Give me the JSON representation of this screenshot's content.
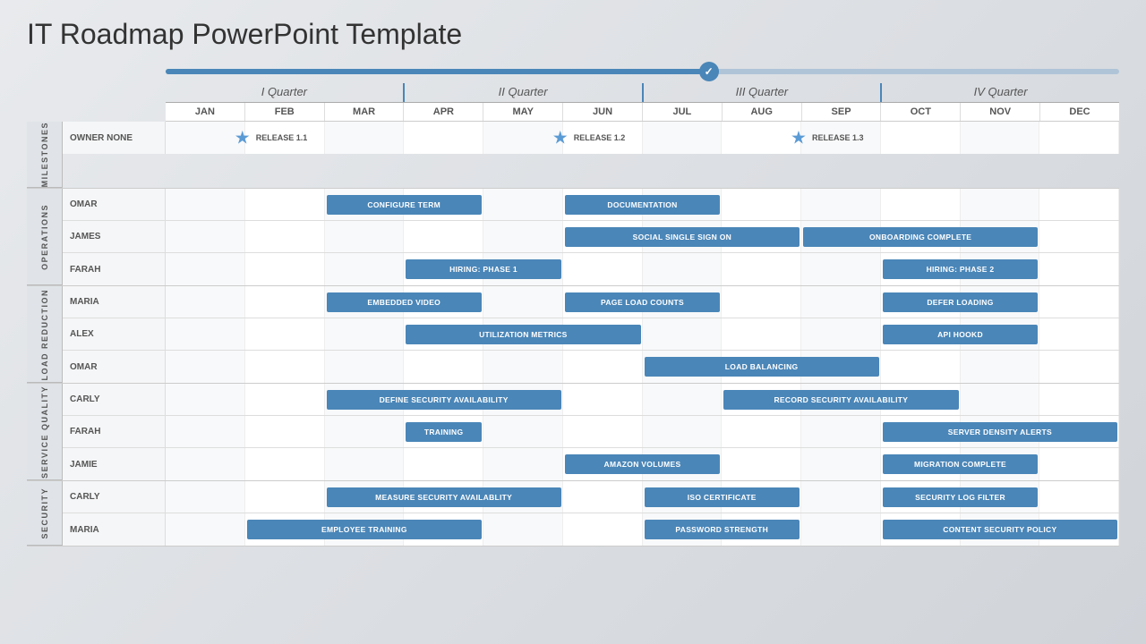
{
  "title": "IT Roadmap PowerPoint Template",
  "progress": {
    "fill_percent": 58
  },
  "quarters": [
    {
      "label": "I Quarter"
    },
    {
      "label": "II Quarter"
    },
    {
      "label": "III Quarter"
    },
    {
      "label": "IV Quarter"
    }
  ],
  "months": [
    "JAN",
    "FEB",
    "MAR",
    "APR",
    "MAY",
    "JUN",
    "JUL",
    "AUG",
    "SEP",
    "OCT",
    "NOV",
    "DEC"
  ],
  "sections": [
    {
      "label": "MILESTONES",
      "rows": [
        {
          "owner": "OWNER NONE",
          "tasks": [
            {
              "label": "RELEASE 1.1",
              "start": 2,
              "span": 2,
              "type": "milestone",
              "star": true
            },
            {
              "label": "RELEASE 1.2",
              "start": 6,
              "span": 2,
              "type": "milestone",
              "star": true
            },
            {
              "label": "RELEASE 1.3",
              "start": 9,
              "span": 2,
              "type": "milestone",
              "star": true
            }
          ]
        }
      ]
    },
    {
      "label": "OPERATIONS",
      "rows": [
        {
          "owner": "OMAR",
          "tasks": [
            {
              "label": "CONFIGURE TERM",
              "start": 3,
              "span": 2
            },
            {
              "label": "DOCUMENTATION",
              "start": 6,
              "span": 2
            }
          ]
        },
        {
          "owner": "JAMES",
          "tasks": [
            {
              "label": "SOCIAL SINGLE SIGN ON",
              "start": 6,
              "span": 3
            },
            {
              "label": "ONBOARDING COMPLETE",
              "start": 9,
              "span": 3
            }
          ]
        },
        {
          "owner": "FARAH",
          "tasks": [
            {
              "label": "HIRING: PHASE 1",
              "start": 4,
              "span": 2
            },
            {
              "label": "HIRING: PHASE 2",
              "start": 10,
              "span": 2
            }
          ]
        }
      ]
    },
    {
      "label": "LOAD REDUCTION",
      "rows": [
        {
          "owner": "MARIA",
          "tasks": [
            {
              "label": "EMBEDDED VIDEO",
              "start": 3,
              "span": 2
            },
            {
              "label": "PAGE LOAD COUNTS",
              "start": 6,
              "span": 2
            },
            {
              "label": "DEFER LOADING",
              "start": 10,
              "span": 2
            }
          ]
        },
        {
          "owner": "ALEX",
          "tasks": [
            {
              "label": "UTILIZATION METRICS",
              "start": 4,
              "span": 3
            },
            {
              "label": "API HOOKD",
              "start": 10,
              "span": 2
            }
          ]
        },
        {
          "owner": "OMAR",
          "tasks": [
            {
              "label": "LOAD BALANCING",
              "start": 7,
              "span": 3
            }
          ]
        }
      ]
    },
    {
      "label": "SERVICE QUALITY",
      "rows": [
        {
          "owner": "CARLY",
          "tasks": [
            {
              "label": "DEFINE SECURITY AVAILABILITY",
              "start": 3,
              "span": 3
            },
            {
              "label": "RECORD SECURITY AVAILABILITY",
              "start": 8,
              "span": 3
            }
          ]
        },
        {
          "owner": "FARAH",
          "tasks": [
            {
              "label": "TRAINING",
              "start": 4,
              "span": 1
            },
            {
              "label": "SERVER DENSITY ALERTS",
              "start": 10,
              "span": 3
            }
          ]
        },
        {
          "owner": "JAMIE",
          "tasks": [
            {
              "label": "AMAZON VOLUMES",
              "start": 6,
              "span": 2
            },
            {
              "label": "MIGRATION COMPLETE",
              "start": 10,
              "span": 2
            }
          ]
        }
      ]
    },
    {
      "label": "SECURITY",
      "rows": [
        {
          "owner": "CARLY",
          "tasks": [
            {
              "label": "MEASURE SECURITY AVAILABLITY",
              "start": 3,
              "span": 3
            },
            {
              "label": "ISO CERTIFICATE",
              "start": 7,
              "span": 2
            },
            {
              "label": "SECURITY LOG FILTER",
              "start": 10,
              "span": 2
            }
          ]
        },
        {
          "owner": "MARIA",
          "tasks": [
            {
              "label": "EMPLOYEE TRAINING",
              "start": 2,
              "span": 3
            },
            {
              "label": "PASSWORD STRENGTH",
              "start": 7,
              "span": 2
            },
            {
              "label": "CONTENT SECURITY POLICY",
              "start": 10,
              "span": 3
            }
          ]
        }
      ]
    }
  ]
}
